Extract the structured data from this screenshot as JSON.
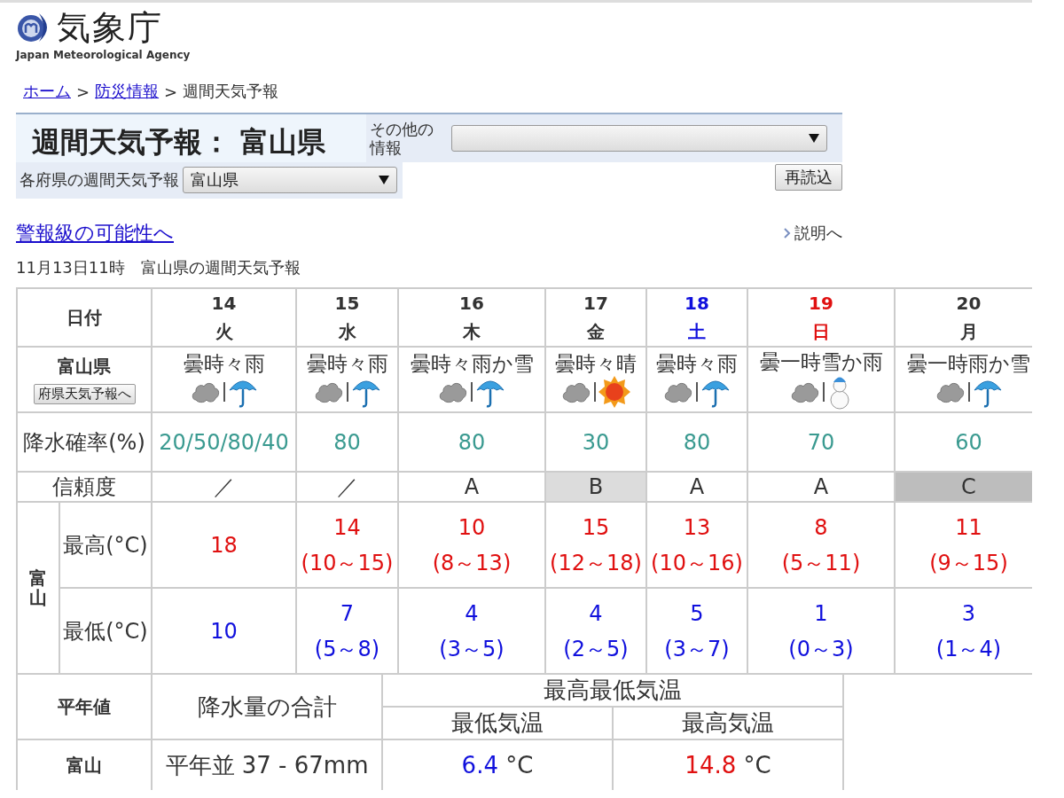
{
  "logo": {
    "name": "気象庁",
    "subtitle": "Japan Meteorological Agency"
  },
  "breadcrumb": [
    {
      "label": "ホーム",
      "link": true
    },
    {
      "label": "防災情報",
      "link": true
    },
    {
      "label": "週間天気予報",
      "link": false
    }
  ],
  "breadcrumb_separator": ">",
  "title": "週間天気予報： 富山県",
  "other_info": {
    "label": "その他の情報"
  },
  "prefecture_select": {
    "label": "各府県の週間天気予報",
    "value": "富山県"
  },
  "reload_button": "再読込",
  "warning_link": "警報級の可能性へ",
  "explanation_link": "説明へ",
  "issued": "11月13日11時　富山県の週間天気予報",
  "table": {
    "date_header": "日付",
    "area": "富山県",
    "area_button": "府県天気予報へ",
    "pop_header": "降水確率(%)",
    "reliability_header": "信頼度",
    "city": "富山",
    "max_header": "最高(°C)",
    "min_header": "最低(°C)",
    "days": [
      {
        "date": "14",
        "weekday": "火",
        "kind": "weekday",
        "forecast": "曇時々雨",
        "icons": [
          {
            "kind": "cloud"
          },
          {
            "kind": "umbrella"
          }
        ],
        "pop": "20/50/80/40",
        "reliability": {
          "text": "／",
          "kind": "plain"
        },
        "max": "18",
        "min": "10"
      },
      {
        "date": "15",
        "weekday": "水",
        "kind": "weekday",
        "forecast": "曇時々雨",
        "icons": [
          {
            "kind": "cloud"
          },
          {
            "kind": "umbrella"
          }
        ],
        "pop": "80",
        "reliability": {
          "text": "／",
          "kind": "plain"
        },
        "max": "14",
        "max_range": "(10～15)",
        "min": "7",
        "min_range": "(5～8)"
      },
      {
        "date": "16",
        "weekday": "木",
        "kind": "weekday",
        "forecast": "曇時々雨か雪",
        "icons": [
          {
            "kind": "cloud"
          },
          {
            "kind": "umbrella"
          }
        ],
        "pop": "80",
        "reliability": {
          "text": "A",
          "kind": "plain"
        },
        "max": "10",
        "max_range": "(8～13)",
        "min": "4",
        "min_range": "(3～5)"
      },
      {
        "date": "17",
        "weekday": "金",
        "kind": "weekday",
        "forecast": "曇時々晴",
        "icons": [
          {
            "kind": "cloud"
          },
          {
            "kind": "sun"
          }
        ],
        "pop": "30",
        "reliability": {
          "text": "B",
          "kind": "light"
        },
        "max": "15",
        "max_range": "(12～18)",
        "min": "4",
        "min_range": "(2～5)"
      },
      {
        "date": "18",
        "weekday": "土",
        "kind": "saturday",
        "forecast": "曇時々雨",
        "icons": [
          {
            "kind": "cloud"
          },
          {
            "kind": "umbrella"
          }
        ],
        "pop": "80",
        "reliability": {
          "text": "A",
          "kind": "plain"
        },
        "max": "13",
        "max_range": "(10～16)",
        "min": "5",
        "min_range": "(3～7)"
      },
      {
        "date": "19",
        "weekday": "日",
        "kind": "sunday",
        "forecast": "曇一時雪か雨",
        "icons": [
          {
            "kind": "cloud"
          },
          {
            "kind": "snowman"
          }
        ],
        "pop": "70",
        "reliability": {
          "text": "A",
          "kind": "plain"
        },
        "max": "8",
        "max_range": "(5～11)",
        "min": "1",
        "min_range": "(0～3)"
      },
      {
        "date": "20",
        "weekday": "月",
        "kind": "weekday",
        "forecast": "曇一時雨か雪",
        "icons": [
          {
            "kind": "cloud"
          },
          {
            "kind": "umbrella"
          }
        ],
        "pop": "60",
        "reliability": {
          "text": "C",
          "kind": "dark"
        },
        "max": "11",
        "max_range": "(9～15)",
        "min": "3",
        "min_range": "(1～4)"
      }
    ]
  },
  "normals": {
    "header": "平年値",
    "precip_header": "降水量の合計",
    "temp_header": "最高最低気温",
    "min_header": "最低気温",
    "max_header": "最高気温",
    "city": "富山",
    "precip": "平年並 37 - 67mm",
    "min_value": "6.4",
    "min_unit": "°C",
    "max_value": "14.8",
    "max_unit": "°C"
  }
}
